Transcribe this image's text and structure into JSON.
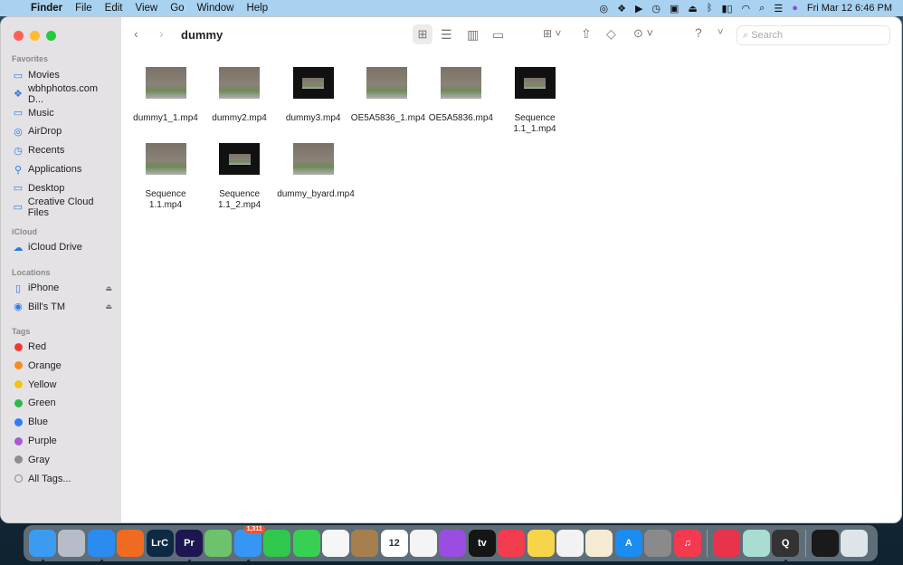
{
  "menubar": {
    "app": "Finder",
    "items": [
      "File",
      "Edit",
      "View",
      "Go",
      "Window",
      "Help"
    ],
    "clock": "Fri Mar 12  6:46 PM"
  },
  "window": {
    "title": "dummy",
    "search_placeholder": "Search"
  },
  "sidebar": {
    "favorites_label": "Favorites",
    "favorites": [
      {
        "label": "Movies",
        "icon": "folder-icon"
      },
      {
        "label": "wbhphotos.com D...",
        "icon": "dropbox-icon"
      },
      {
        "label": "Music",
        "icon": "folder-icon"
      },
      {
        "label": "AirDrop",
        "icon": "airdrop-icon"
      },
      {
        "label": "Recents",
        "icon": "clock-icon"
      },
      {
        "label": "Applications",
        "icon": "applications-icon"
      },
      {
        "label": "Desktop",
        "icon": "folder-icon"
      },
      {
        "label": "Creative Cloud Files",
        "icon": "folder-icon"
      }
    ],
    "icloud_label": "iCloud",
    "icloud": [
      {
        "label": "iCloud Drive",
        "icon": "cloud-icon"
      }
    ],
    "locations_label": "Locations",
    "locations": [
      {
        "label": "iPhone",
        "icon": "phone-icon"
      },
      {
        "label": "Bill's TM",
        "icon": "disk-icon"
      }
    ],
    "tags_label": "Tags",
    "tags": [
      {
        "label": "Red",
        "color": "#f03a30"
      },
      {
        "label": "Orange",
        "color": "#f58a1f"
      },
      {
        "label": "Yellow",
        "color": "#f5c21b"
      },
      {
        "label": "Green",
        "color": "#32b84a"
      },
      {
        "label": "Blue",
        "color": "#2f7cf6"
      },
      {
        "label": "Purple",
        "color": "#a55bd3"
      },
      {
        "label": "Gray",
        "color": "#8e8e92"
      },
      {
        "label": "All Tags...",
        "color": ""
      }
    ]
  },
  "files": [
    {
      "name": "dummy1_1.mp4",
      "letterbox": false
    },
    {
      "name": "dummy2.mp4",
      "letterbox": false
    },
    {
      "name": "dummy3.mp4",
      "letterbox": true
    },
    {
      "name": "OE5A5836_1.mp4",
      "letterbox": false
    },
    {
      "name": "OE5A5836.mp4",
      "letterbox": false
    },
    {
      "name": "Sequence 1.1_1.mp4",
      "letterbox": true
    },
    {
      "name": "Sequence 1.1.mp4",
      "letterbox": false
    },
    {
      "name": "Sequence 1.1_2.mp4",
      "letterbox": true
    },
    {
      "name": "dummy_byard.mp4",
      "letterbox": false
    }
  ],
  "dock": [
    {
      "name": "finder",
      "label": "",
      "color": "#3a9bf0",
      "running": true
    },
    {
      "name": "launchpad",
      "label": "",
      "color": "#b8bcc6",
      "running": false
    },
    {
      "name": "safari",
      "label": "",
      "color": "#2b8cf0",
      "running": true
    },
    {
      "name": "firefox",
      "label": "",
      "color": "#f06a20",
      "running": false
    },
    {
      "name": "lightroom-classic",
      "label": "LrC",
      "color": "#0d2a44",
      "running": false
    },
    {
      "name": "premiere",
      "label": "Pr",
      "color": "#1d1650",
      "running": true
    },
    {
      "name": "maps",
      "label": "",
      "color": "#6cc36b",
      "running": false
    },
    {
      "name": "mail",
      "label": "",
      "color": "#3696f4",
      "running": true,
      "badge": "1,311"
    },
    {
      "name": "facetime",
      "label": "",
      "color": "#2fc84c",
      "running": false
    },
    {
      "name": "messages",
      "label": "",
      "color": "#38d052",
      "running": false
    },
    {
      "name": "photos",
      "label": "",
      "color": "#f6f6f6",
      "running": false
    },
    {
      "name": "contacts",
      "label": "",
      "color": "#a5804e",
      "running": false
    },
    {
      "name": "calendar",
      "label": "12",
      "color": "#ffffff",
      "running": false
    },
    {
      "name": "reminders",
      "label": "",
      "color": "#f4f4f4",
      "running": false
    },
    {
      "name": "podcasts",
      "label": "",
      "color": "#9a4de0",
      "running": false
    },
    {
      "name": "tv",
      "label": "tv",
      "color": "#151515",
      "running": false
    },
    {
      "name": "news",
      "label": "",
      "color": "#f23d4f",
      "running": false
    },
    {
      "name": "notes",
      "label": "",
      "color": "#f7d54a",
      "running": false
    },
    {
      "name": "numbers",
      "label": "",
      "color": "#f2f2f2",
      "running": false
    },
    {
      "name": "pages",
      "label": "",
      "color": "#f5ebd2",
      "running": false
    },
    {
      "name": "app-store",
      "label": "A",
      "color": "#1a8cf2",
      "running": false
    },
    {
      "name": "system-preferences",
      "label": "",
      "color": "#8a8a8a",
      "running": false
    },
    {
      "name": "music",
      "label": "♫",
      "color": "#f53a50",
      "running": false
    },
    {
      "name": "creative-cloud",
      "label": "",
      "color": "#e8334a",
      "running": false
    },
    {
      "name": "plugin-scan",
      "label": "",
      "color": "#a9ddd2",
      "running": false
    },
    {
      "name": "quicktime",
      "label": "Q",
      "color": "#333",
      "running": true
    },
    {
      "name": "downloads-stack",
      "label": "",
      "color": "#1a1a1a",
      "running": false
    },
    {
      "name": "trash",
      "label": "",
      "color": "#dfe4e8",
      "running": false
    }
  ]
}
